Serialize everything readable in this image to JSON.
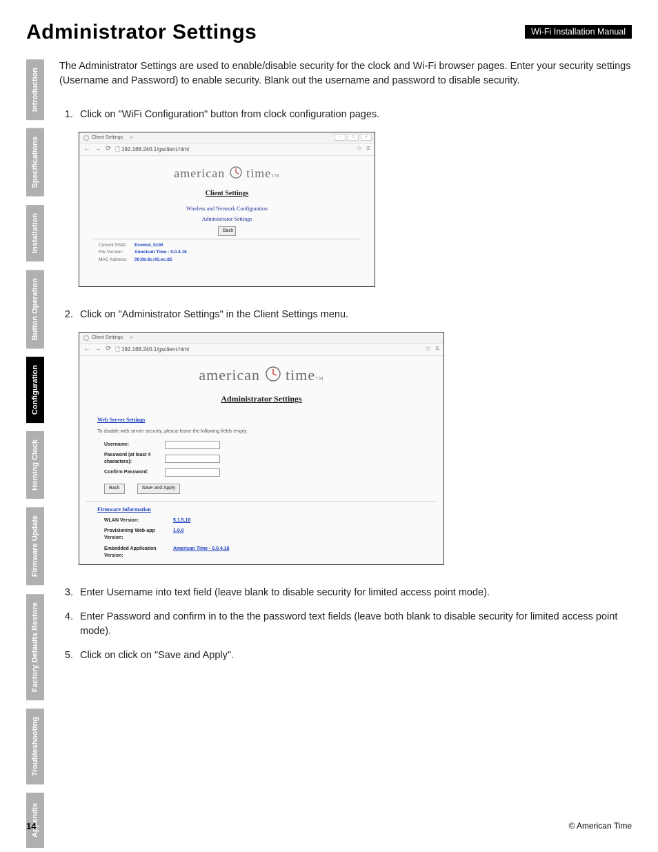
{
  "header": {
    "title": "Administrator Settings",
    "badge": "Wi-Fi Installation Manual"
  },
  "tabs": [
    {
      "label": "Introduction",
      "active": false
    },
    {
      "label": "Specifications",
      "active": false
    },
    {
      "label": "Installation",
      "active": false
    },
    {
      "label": "Button Operation",
      "active": false
    },
    {
      "label": "Configuration",
      "active": true
    },
    {
      "label": "Homing Clock",
      "active": false
    },
    {
      "label": "Firmware Update",
      "active": false
    },
    {
      "label": "Factory Defaults Restore",
      "active": false
    },
    {
      "label": "Troubleshooting",
      "active": false
    },
    {
      "label": "Appendix",
      "active": false
    }
  ],
  "intro": "The Administrator Settings are used to enable/disable security for the clock and Wi-Fi browser pages. Enter your security settings (Username and Password) to enable security. Blank out the username and password to disable security.",
  "steps": {
    "s1": "Click on \"WiFi Configuration\" button from clock configuration pages.",
    "s2": "Click on \"Administrator Settings\" in the Client Settings menu.",
    "s3": "Enter Username into text field (leave blank to disable security for limited access point mode).",
    "s4": "Enter Password and confirm in to the the password text fields (leave both blank to disable security for limited access point mode).",
    "s5": "Click on click on \"Save and Apply\"."
  },
  "shot1": {
    "tab_title": "Client Settings",
    "url": "192.168.240.1/gsclient.html",
    "logo_a": "american",
    "logo_b": "time",
    "tm": "TM",
    "heading": "Client Settings",
    "link1": "Wireless and Network Configuration",
    "link2": "Administrator Settings",
    "back": "Back",
    "info": [
      {
        "lbl": "Current SSID:",
        "val": "Econo4_5100"
      },
      {
        "lbl": "FW Version:",
        "val": "American Time - 0.0.4.16"
      },
      {
        "lbl": "MAC Address:",
        "val": "00:0b:6c:41:ec:85"
      }
    ]
  },
  "shot2": {
    "tab_title": "Client Settings",
    "url": "192.168.240.1/gsclient.html",
    "logo_a": "american",
    "logo_b": "time",
    "tm": "TM",
    "heading": "Administrator Settings",
    "subhead": "Web Server Settings",
    "hint": "To disable web server security, please leave the following fields empty.",
    "f_user": "Username:",
    "f_pass": "Password (at least 4 characters):",
    "f_conf": "Confirm Password:",
    "back": "Back",
    "save": "Save and Apply",
    "fw_head": "Firmware Information",
    "fw": [
      {
        "lbl": "WLAN Version:",
        "val": "5.1.5.10"
      },
      {
        "lbl": "Provisioning Web-app Version:",
        "val": "1.0.0"
      },
      {
        "lbl": "Embedded Application Version:",
        "val": "American Time - 0.0.4.16"
      }
    ]
  },
  "footer": {
    "page": "14",
    "copy": "© American Time"
  }
}
